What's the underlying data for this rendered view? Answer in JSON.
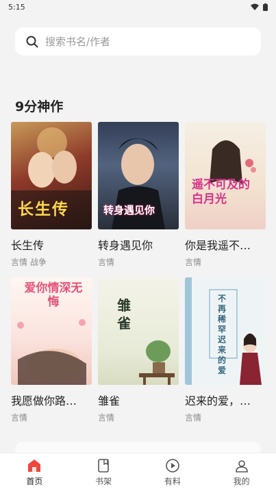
{
  "status": {
    "time": "5:15"
  },
  "search": {
    "placeholder": "搜索书名/作者"
  },
  "section": {
    "title": "9分神作"
  },
  "books": [
    {
      "title": "长生传",
      "tags": "言情 战争",
      "cover_text": "长生传"
    },
    {
      "title": "转身遇见你",
      "tags": "言情",
      "cover_text": "转身遇见你"
    },
    {
      "title": "你是我遥不…",
      "tags": "言情",
      "cover_text": "遥不可及的白月光"
    },
    {
      "title": "我愿做你路…",
      "tags": "言情",
      "cover_text": "爱你情深无悔"
    },
    {
      "title": "雏雀",
      "tags": "言情",
      "cover_text": "雏雀"
    },
    {
      "title": "迟来的爱，…",
      "tags": "言情",
      "cover_text": "不再稀罕迟来的爱"
    }
  ],
  "tabs": [
    {
      "label": "首页",
      "icon": "home-icon",
      "active": true
    },
    {
      "label": "书架",
      "icon": "bookshelf-icon",
      "active": false
    },
    {
      "label": "有料",
      "icon": "play-icon",
      "active": false
    },
    {
      "label": "我的",
      "icon": "profile-icon",
      "active": false
    }
  ],
  "colors": {
    "accent": "#f0463c",
    "background": "#f3f3f3"
  }
}
